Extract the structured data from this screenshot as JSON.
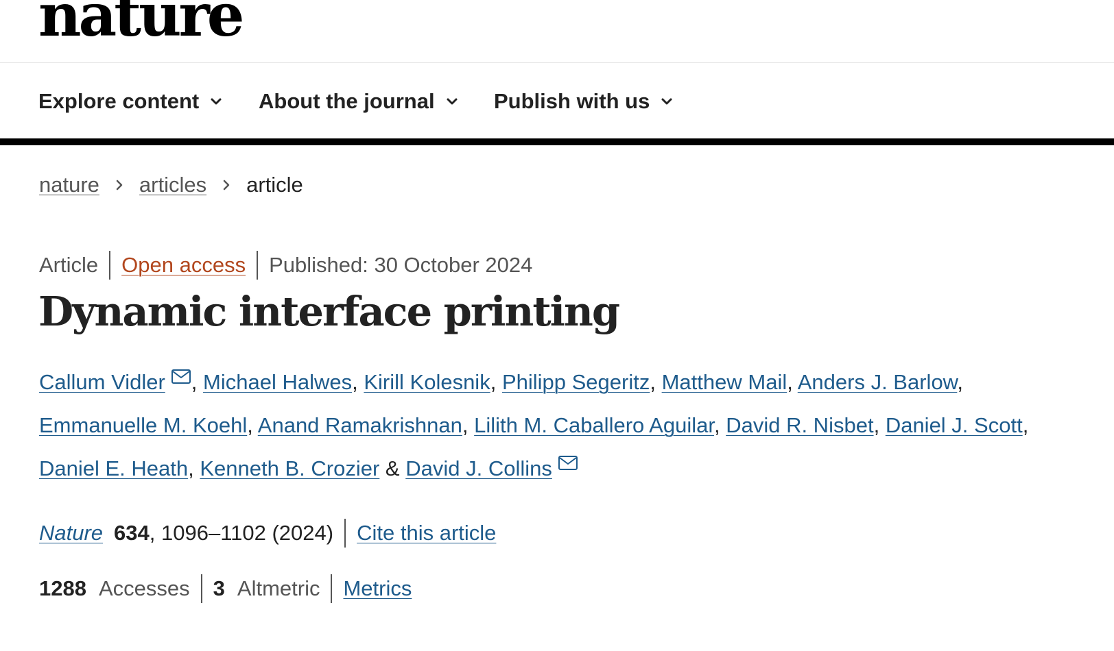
{
  "header": {
    "logo": "nature"
  },
  "nav": {
    "items": [
      {
        "label": "Explore content",
        "icon": "chevron-down-icon"
      },
      {
        "label": "About the journal",
        "icon": "chevron-down-icon"
      },
      {
        "label": "Publish with us",
        "icon": "chevron-down-icon"
      }
    ]
  },
  "breadcrumb": {
    "items": [
      "nature",
      "articles"
    ],
    "current": "article",
    "separator_icon": "chevron-right-icon"
  },
  "article": {
    "type": "Article",
    "access": "Open access",
    "published": "Published: 30 October 2024",
    "title": "Dynamic interface printing",
    "authors": [
      "Callum Vidler",
      "Michael Halwes",
      "Kirill Kolesnik",
      "Philipp Segeritz",
      "Matthew Mail",
      "Anders J. Barlow",
      "Emmanuelle M. Koehl",
      "Anand Ramakrishnan",
      "Lilith M. Caballero Aguilar",
      "David R. Nisbet",
      "Daniel J. Scott",
      "Daniel E. Heath",
      "Kenneth B. Crozier",
      "David J. Collins"
    ],
    "author_separator": ",",
    "author_last_separator": "&",
    "mail_icon": "mail-icon",
    "citation": {
      "journal": "Nature",
      "volume": "634",
      "pages_year": ", 1096–1102 (2024)",
      "cite_label": "Cite this article"
    },
    "metrics": {
      "accesses_value": "1288",
      "accesses_label": "Accesses",
      "altmetric_value": "3",
      "altmetric_label": "Altmetric",
      "metrics_label": "Metrics"
    }
  },
  "colors": {
    "link": "#1e5b8c",
    "open_access": "#b2471e",
    "text": "#222222",
    "muted": "#555555",
    "nav_border": "#000000"
  }
}
